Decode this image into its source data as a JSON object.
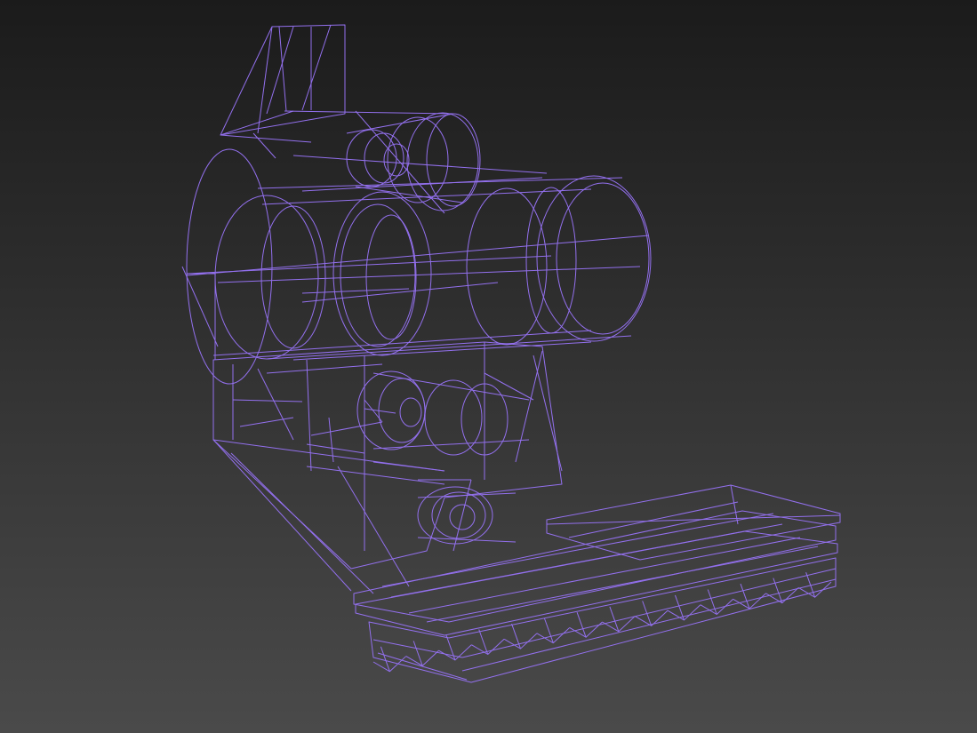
{
  "viewport": {
    "background_top": "#1b1b1b",
    "background_bottom": "#4a4a4a",
    "wire_color": "#9370ee",
    "render_mode": "wireframe"
  }
}
